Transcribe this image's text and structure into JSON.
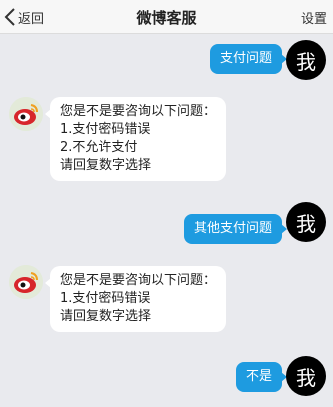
{
  "header": {
    "back_label": "返回",
    "title": "微博客服",
    "settings_label": "设置"
  },
  "me_avatar_label": "我",
  "messages": [
    {
      "from": "me",
      "text": "支付问题"
    },
    {
      "from": "cs",
      "lines": [
        "您是不是要咨询以下问题：",
        "1.支付密码错误",
        "2.不允许支付",
        "请回复数字选择"
      ]
    },
    {
      "from": "me",
      "text": "其他支付问题"
    },
    {
      "from": "cs",
      "lines": [
        "您是不是要咨询以下问题：",
        "1.支付密码错误",
        "请回复数字选择"
      ]
    },
    {
      "from": "me",
      "text": "不是"
    }
  ],
  "colors": {
    "my_bubble": "#1e9be0",
    "cs_bubble": "#ffffff",
    "background": "#e9eaee"
  },
  "icons": {
    "back": "chevron-left-icon",
    "cs_avatar": "weibo-logo-icon"
  }
}
